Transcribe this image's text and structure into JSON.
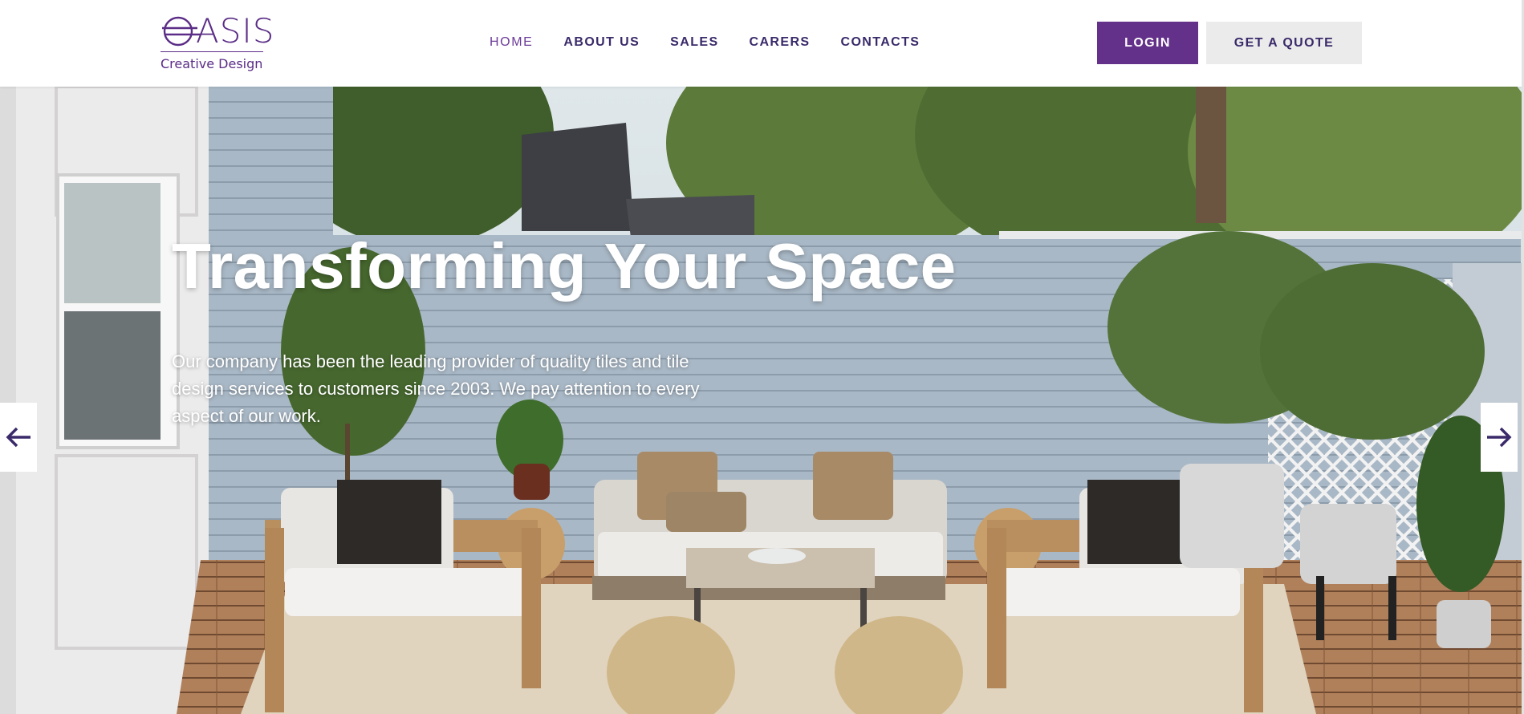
{
  "brand": {
    "name": "ASIS",
    "tagline": "Creative Design",
    "color": "#5b2d87"
  },
  "nav": {
    "items": [
      {
        "label": "HOME",
        "active": true
      },
      {
        "label": "ABOUT US"
      },
      {
        "label": "SALES"
      },
      {
        "label": "CARERS"
      },
      {
        "label": "CONTACTS"
      }
    ]
  },
  "header_actions": {
    "login": "LOGIN",
    "quote": "GET A QUOTE"
  },
  "hero": {
    "title": "Transforming Your Space",
    "description": "Our company has been the leading provider of quality tiles and tile design services to customers since 2003. We pay attention to every aspect of our work.",
    "prev_icon": "arrow-left-icon",
    "next_icon": "arrow-right-icon"
  },
  "colors": {
    "accent": "#64318a",
    "nav_text": "#3a2a6a",
    "quote_bg": "#ebebeb"
  }
}
